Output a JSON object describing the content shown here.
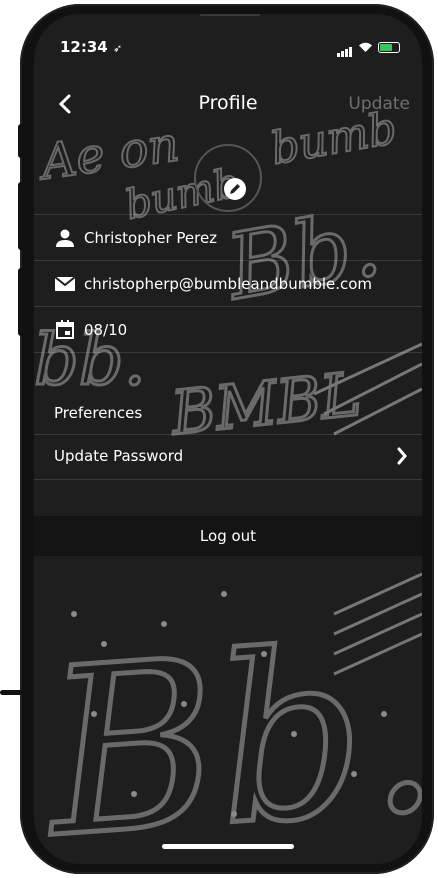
{
  "status": {
    "time": "12:34",
    "location_icon": "location-arrow-icon",
    "battery_color": "#35c759"
  },
  "nav": {
    "title": "Profile",
    "update_label": "Update",
    "back_icon": "chevron-left-icon"
  },
  "avatar": {
    "edit_icon": "pencil-icon"
  },
  "fields": [
    {
      "icon": "person-icon",
      "value": "Christopher Perez"
    },
    {
      "icon": "mail-icon",
      "value": "christopherp@bumbleandbumble.com"
    },
    {
      "icon": "calendar-icon",
      "value": "08/10"
    }
  ],
  "preferences": {
    "label": "Preferences",
    "update_password_label": "Update Password",
    "chevron_icon": "chevron-right-icon"
  },
  "logout_label": "Log out",
  "colors": {
    "background": "#1e1e1e",
    "text": "#ffffff",
    "update_disabled": "#6f6f6f"
  }
}
